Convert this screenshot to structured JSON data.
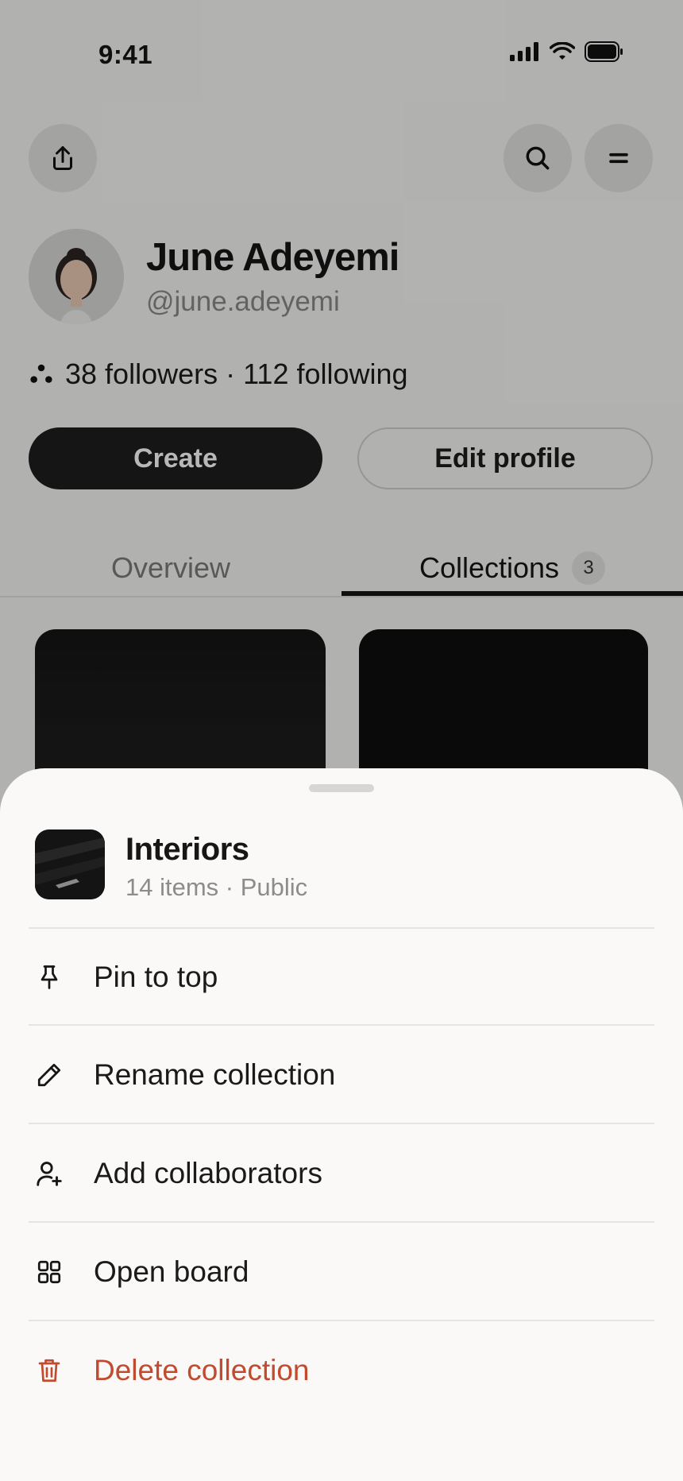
{
  "status_bar": {
    "time": "9:41"
  },
  "header": {
    "share_icon": "share-icon",
    "search_icon": "search-icon",
    "menu_icon": "menu-icon"
  },
  "profile": {
    "name": "June Adeyemi",
    "handle": "@june.adeyemi",
    "follow_text": "38 followers · 112 following",
    "create_label": "Create",
    "edit_label": "Edit profile"
  },
  "tabs": [
    {
      "label": "Overview",
      "active": false
    },
    {
      "label": "Collections",
      "badge": "3",
      "active": true
    }
  ],
  "sheet": {
    "title": "Interiors",
    "subtitle": "14 items · Public",
    "items": [
      {
        "label": "Pin to top",
        "icon": "pin-icon"
      },
      {
        "label": "Rename collection",
        "icon": "pencil-icon"
      },
      {
        "label": "Add collaborators",
        "icon": "user-plus-icon"
      },
      {
        "label": "Open board",
        "icon": "grid-icon"
      },
      {
        "label": "Delete collection",
        "icon": "trash-icon",
        "danger": true
      }
    ]
  },
  "colors": {
    "accent_dark": "#1e1e1e",
    "danger": "#c24a2f",
    "sheet_background": "#faf9f7"
  }
}
